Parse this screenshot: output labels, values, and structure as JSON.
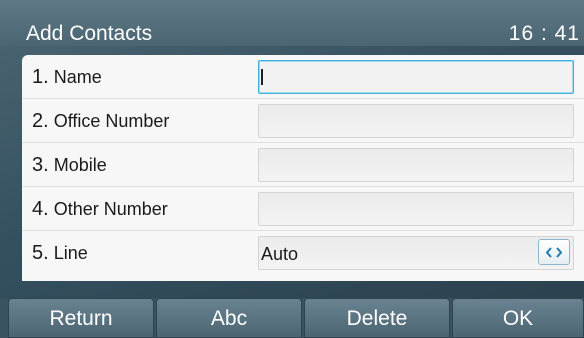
{
  "header": {
    "title": "Add Contacts",
    "clock": "16 : 41"
  },
  "form": {
    "rows": [
      {
        "num": "1.",
        "label": "Name",
        "value": ""
      },
      {
        "num": "2.",
        "label": "Office Number",
        "value": ""
      },
      {
        "num": "3.",
        "label": "Mobile",
        "value": ""
      },
      {
        "num": "4.",
        "label": "Other Number",
        "value": ""
      },
      {
        "num": "5.",
        "label": "Line",
        "value": "Auto"
      }
    ]
  },
  "softkeys": [
    {
      "label": "Return"
    },
    {
      "label": "Abc"
    },
    {
      "label": "Delete"
    },
    {
      "label": "OK"
    }
  ],
  "icons": {
    "line_switch": "left-right-arrows-icon"
  },
  "colors": {
    "active_field_border": "#3fb3d9",
    "header_bg": "#52707e",
    "softkey_bg": "#5a7482"
  }
}
